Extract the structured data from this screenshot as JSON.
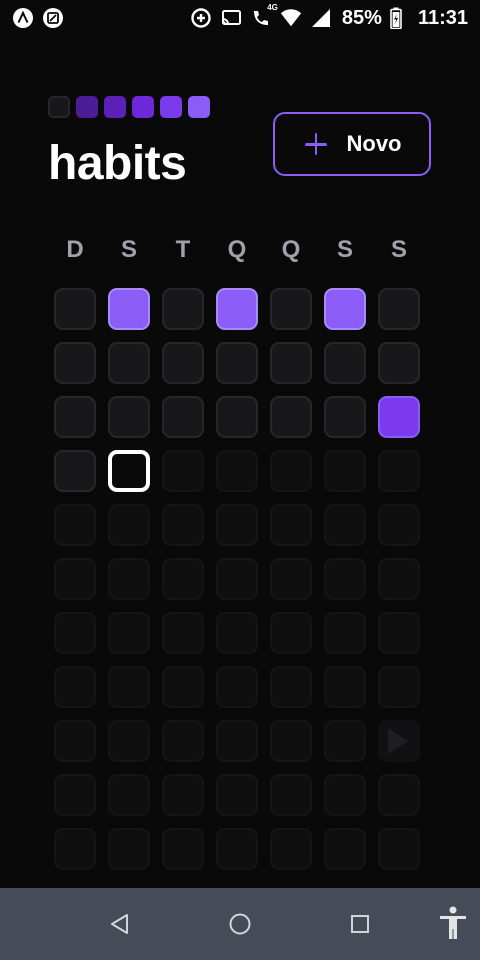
{
  "status_bar": {
    "battery": "85%",
    "time": "11:31",
    "network_label": "4G",
    "icons": [
      "app-a-icon",
      "app-screenshot-icon",
      "data-saver-icon",
      "cast-icon",
      "wifi-calling-icon",
      "wifi-icon",
      "signal-icon",
      "battery-charging-icon"
    ]
  },
  "header": {
    "title": "habits",
    "new_button_label": "Novo",
    "logo_colors": [
      "#18181b",
      "#4c1d95",
      "#5b21b6",
      "#6d28d9",
      "#7c3aed",
      "#8b5cf6"
    ]
  },
  "weekdays": [
    "D",
    "S",
    "T",
    "Q",
    "Q",
    "S",
    "S"
  ],
  "calendar": {
    "rows_visible": 11,
    "completed_days": [
      1,
      3,
      5
    ],
    "strong_completed_days": [
      20
    ],
    "today_index": 22
  },
  "colors": {
    "accent": "#8b5cf6",
    "cell_bg": "#18181b",
    "cell_border": "#27272a",
    "background": "#09090a",
    "nav_bar": "#454c57"
  },
  "navigation": {
    "buttons": [
      "back-icon",
      "home-icon",
      "recents-icon",
      "accessibility-icon"
    ]
  }
}
